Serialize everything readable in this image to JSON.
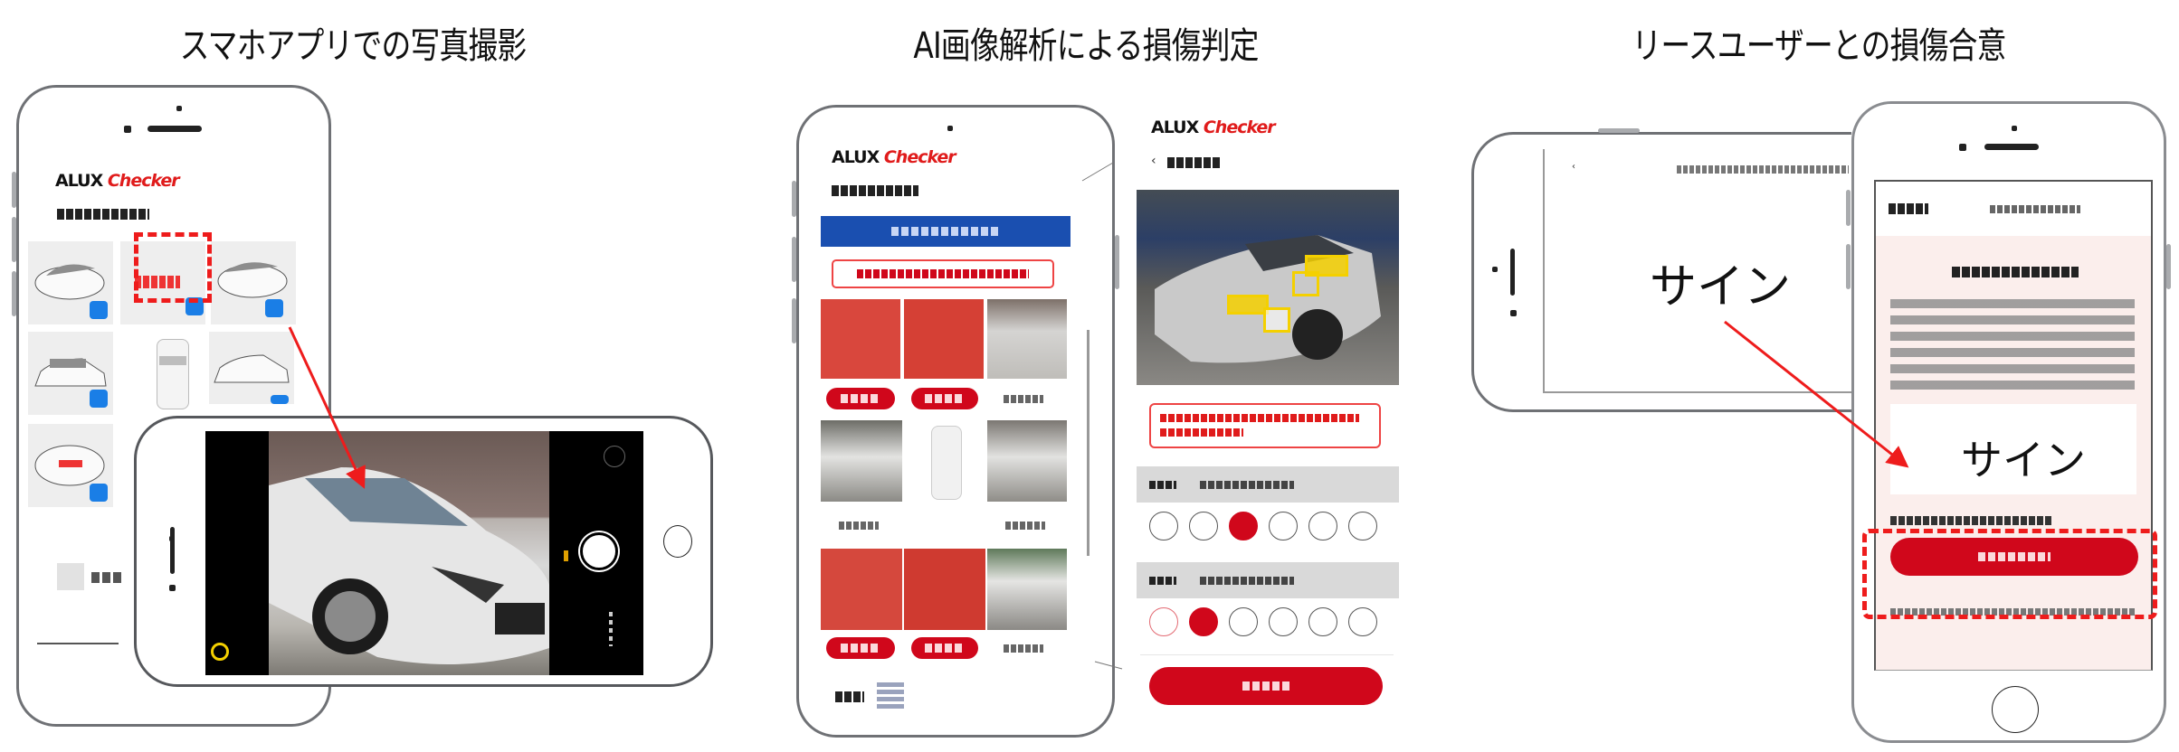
{
  "sections": [
    {
      "heading": "スマホアプリでの写真撮影"
    },
    {
      "heading": "AI画像解析による損傷判定"
    },
    {
      "heading": "リースユーザーとの損傷合意"
    }
  ],
  "brand": {
    "prefix": "ALUX",
    "suffix": "Checker"
  },
  "sign_labels": {
    "landscape": "サイン",
    "portrait": "サイン"
  },
  "colors": {
    "accent_red": "#d0071b",
    "highlight_red": "#ee1c1c",
    "blue_badge": "#1a7ee6",
    "banner_blue": "#1a4fb0",
    "detect_yellow": "#f4d000"
  },
  "analysis": {
    "rating_rows": [
      {
        "selected_index": 2,
        "count": 6
      },
      {
        "selected_index": 1,
        "count": 6
      }
    ]
  }
}
